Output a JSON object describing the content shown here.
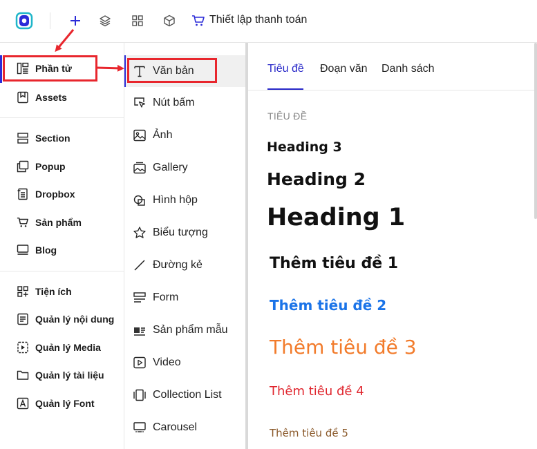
{
  "topbar": {
    "title": "Thiết lập thanh toán",
    "icons": [
      "app-logo",
      "plus-icon",
      "layers-icon",
      "grid-icon",
      "cube-icon",
      "cart-icon"
    ],
    "accent": "#2b2bd8"
  },
  "leftnav": {
    "items": [
      {
        "label": "Phần tử",
        "icon": "elements-icon"
      },
      {
        "label": "Assets",
        "icon": "bookmark-icon"
      },
      {
        "label": "Section",
        "icon": "section-icon"
      },
      {
        "label": "Popup",
        "icon": "popup-icon"
      },
      {
        "label": "Dropbox",
        "icon": "dropbox-icon"
      },
      {
        "label": "Sản phẩm",
        "icon": "cart-icon"
      },
      {
        "label": "Blog",
        "icon": "blog-icon"
      },
      {
        "label": "Tiện ích",
        "icon": "apps-icon"
      },
      {
        "label": "Quản lý nội dung",
        "icon": "content-icon"
      },
      {
        "label": "Quản lý Media",
        "icon": "media-icon"
      },
      {
        "label": "Quản lý tài liệu",
        "icon": "folder-icon"
      },
      {
        "label": "Quản lý Font",
        "icon": "font-icon"
      }
    ]
  },
  "elements": {
    "items": [
      {
        "label": "Văn bản",
        "icon": "text-icon"
      },
      {
        "label": "Nút bấm",
        "icon": "cursor-icon"
      },
      {
        "label": "Ảnh",
        "icon": "image-icon"
      },
      {
        "label": "Gallery",
        "icon": "gallery-icon"
      },
      {
        "label": "Hình hộp",
        "icon": "shapes-icon"
      },
      {
        "label": "Biểu tượng",
        "icon": "star-icon"
      },
      {
        "label": "Đường kẻ",
        "icon": "line-icon"
      },
      {
        "label": "Form",
        "icon": "form-icon"
      },
      {
        "label": "Sản phẩm mẫu",
        "icon": "product-sample-icon"
      },
      {
        "label": "Video",
        "icon": "video-icon"
      },
      {
        "label": "Collection List",
        "icon": "collection-icon"
      },
      {
        "label": "Carousel",
        "icon": "carousel-icon"
      }
    ]
  },
  "panel": {
    "tabs": [
      "Tiêu đề",
      "Đoạn văn",
      "Danh sách"
    ],
    "section_label": "TIÊU ĐỀ",
    "headings": [
      "Heading 3",
      "Heading 2",
      "Heading 1"
    ],
    "titles": [
      "Thêm tiêu đề 1",
      "Thêm tiêu đề 2",
      "Thêm tiêu đề 3",
      "Thêm tiêu đề 4",
      "Thêm tiêu đề 5"
    ],
    "title_colors": [
      "#111111",
      "#1a73e8",
      "#f27b2b",
      "#e0262e",
      "#8b5a2b"
    ]
  },
  "annotation_color": "#e8262d"
}
